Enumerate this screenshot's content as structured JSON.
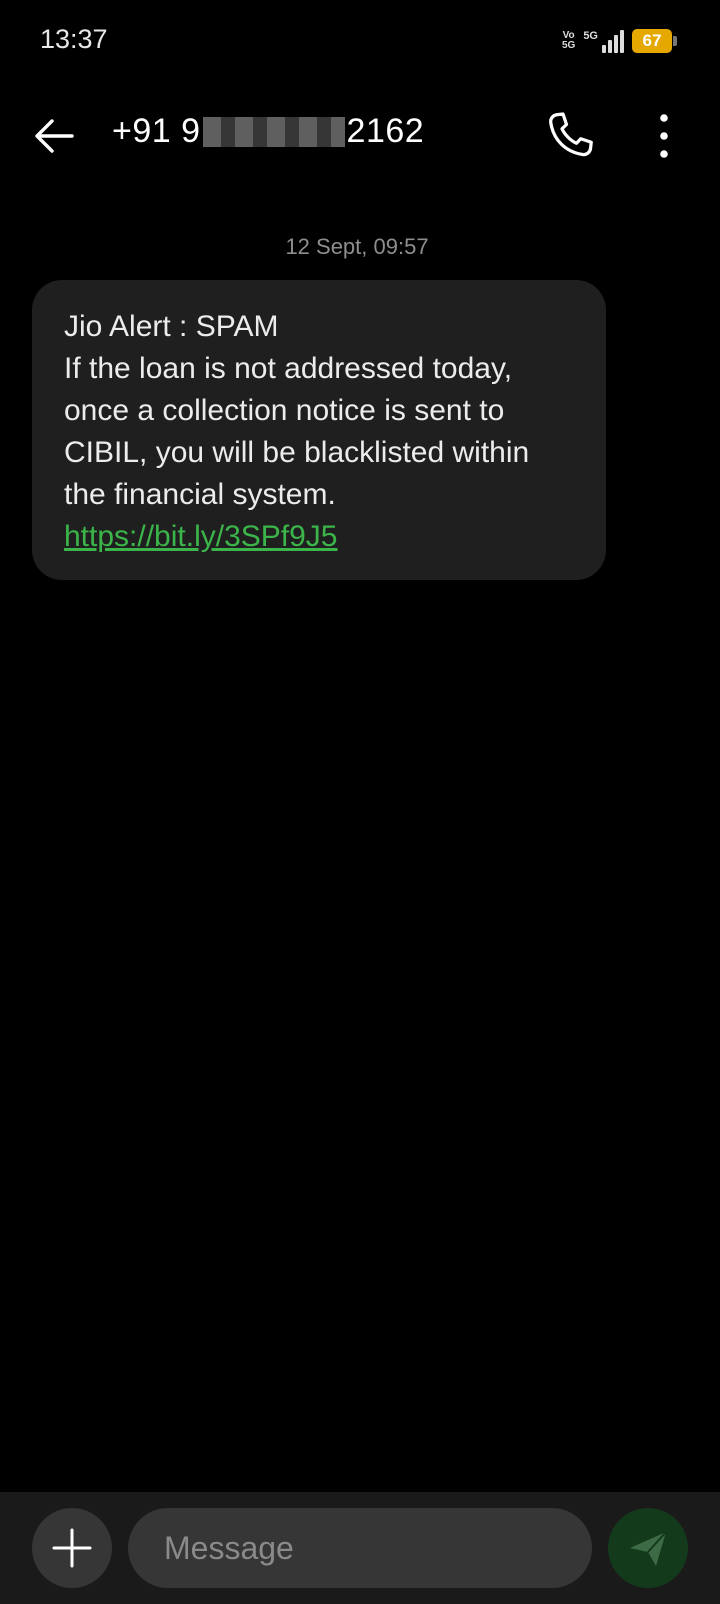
{
  "status_bar": {
    "time": "13:37",
    "volte_top": "Vo",
    "volte_bottom": "5G",
    "network": "5G",
    "battery": "67",
    "battery_color": "#e5a800"
  },
  "header": {
    "phone_prefix": "+91 9",
    "phone_suffix": "2162",
    "back_icon": "arrow-left-icon",
    "call_icon": "phone-icon",
    "more_icon": "more-vertical-icon"
  },
  "conversation": {
    "date": "12 Sept, 09:57",
    "message": {
      "title": "Jio Alert : SPAM",
      "body": "If the loan is not addressed today, once a collection notice is sent to CIBIL, you will be blacklisted within the financial system.",
      "link": "https://bit.ly/3SPf9J5",
      "link_color": "#3bb54a"
    }
  },
  "composer": {
    "placeholder": "Message",
    "attach_icon": "plus-icon",
    "send_icon": "send-icon"
  }
}
